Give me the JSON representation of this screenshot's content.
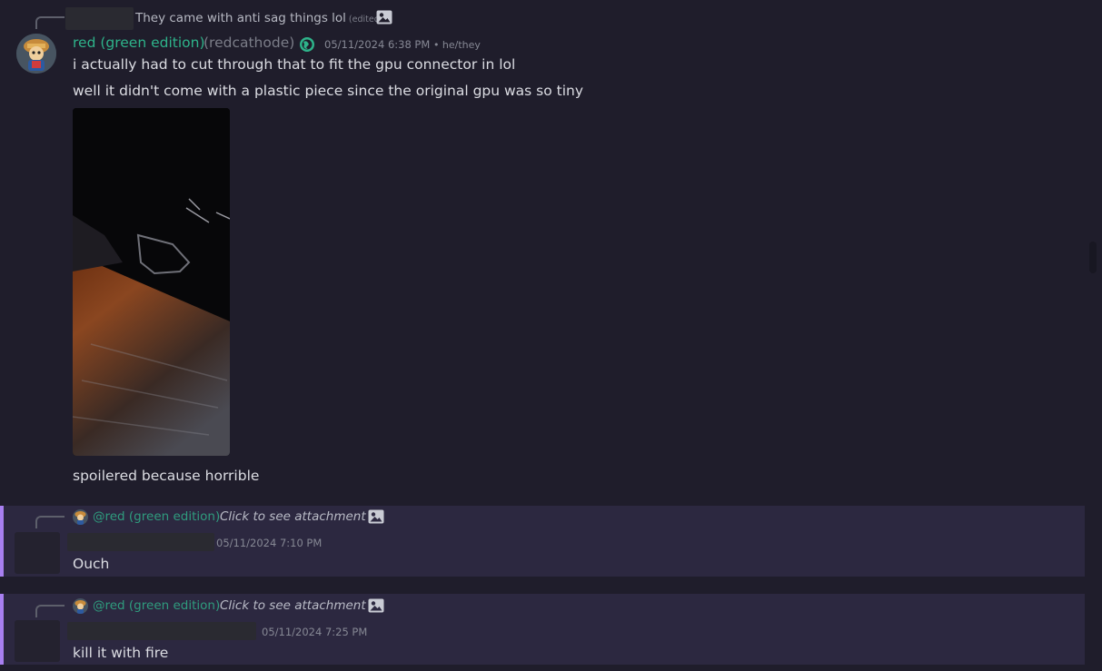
{
  "first_reply": {
    "text": "They came with anti sag things lol",
    "edited_label": "(edited)"
  },
  "message": {
    "author": "red (green edition)",
    "handle": "(redcathode)",
    "timestamp": "05/11/2024 6:38 PM",
    "pronouns": "• he/they",
    "lines": [
      "i actually had to cut through that to fit the gpu connector in lol",
      "well it didn't come with a plastic piece since the original gpu was so tiny"
    ],
    "caption": "spoilered because horrible"
  },
  "replies": [
    {
      "mention": "@red (green edition)",
      "reference_text": "Click to see attachment",
      "timestamp": "05/11/2024 7:10 PM",
      "text": "Ouch"
    },
    {
      "mention": "@red (green edition)",
      "reference_text": "Click to see attachment",
      "timestamp": "05/11/2024 7:25 PM",
      "text": "kill it with fire"
    }
  ],
  "colors": {
    "background": "#1f1d2b",
    "author": "#2eb38a",
    "highlight": "#2c2840",
    "highlight_border": "#a87ff0"
  },
  "icons": [
    "image-icon",
    "globe-icon"
  ]
}
